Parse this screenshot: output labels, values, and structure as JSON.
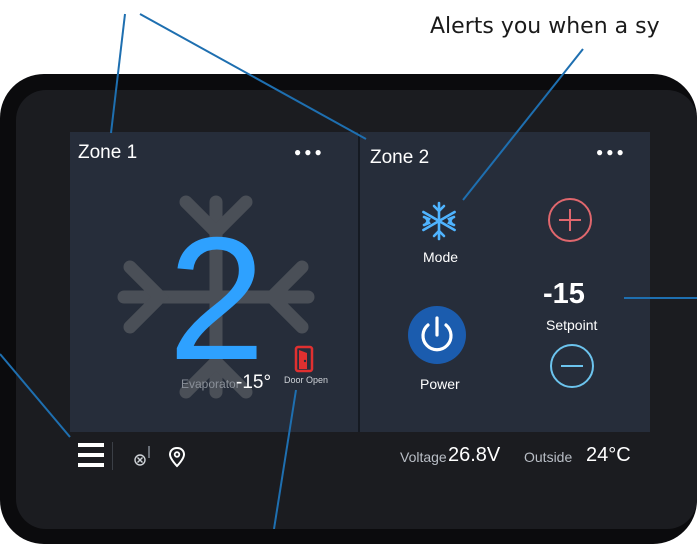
{
  "callout": {
    "text": "Alerts you when a sy"
  },
  "zone1": {
    "title": "Zone 1",
    "menu_dots": "●●●",
    "current_value": "2",
    "evaporator_label": "Evaporator",
    "evaporator_temp": "-15°",
    "door_status": "Door Open"
  },
  "zone2": {
    "title": "Zone 2",
    "menu_dots": "●●●",
    "mode_label": "Mode",
    "setpoint_value": "-15",
    "setpoint_label": "Setpoint",
    "power_label": "Power"
  },
  "status_bar": {
    "voltage_label": "Voltage",
    "voltage_value": "26.8V",
    "outside_label": "Outside",
    "outside_value": "24°C"
  },
  "colors": {
    "accent_blue": "#2ea1ff",
    "power_blue": "#1b5cae",
    "plus_red": "#e0676d",
    "minus_cyan": "#6cc4ee",
    "door_red": "#e03030",
    "callout_line": "#1e6fb0"
  },
  "icons": [
    "snowflake-icon",
    "plus-icon",
    "minus-icon",
    "power-icon",
    "door-icon",
    "menu-icon",
    "signal-icon",
    "location-pin-icon"
  ]
}
